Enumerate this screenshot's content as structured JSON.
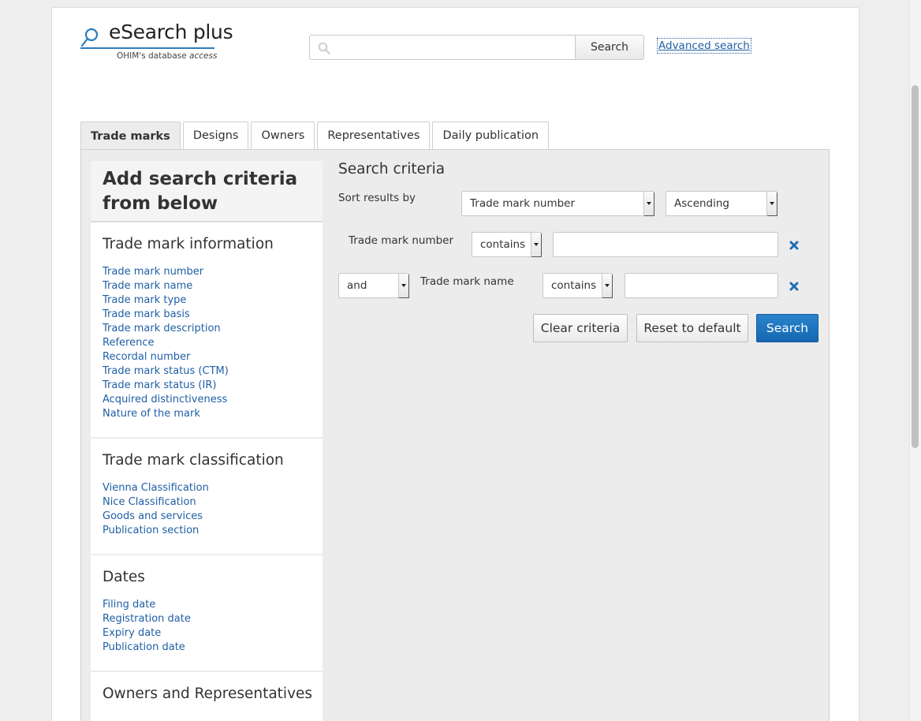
{
  "header": {
    "logo_title": "eSearch plus",
    "logo_subtitle_main": "OHIM's database",
    "logo_subtitle_em": "access",
    "search_placeholder": "",
    "search_button": "Search",
    "advanced_link": "Advanced search"
  },
  "tabs": [
    {
      "label": "Trade marks",
      "active": true
    },
    {
      "label": "Designs",
      "active": false
    },
    {
      "label": "Owners",
      "active": false
    },
    {
      "label": "Representatives",
      "active": false
    },
    {
      "label": "Daily publication",
      "active": false
    }
  ],
  "sidebar": {
    "heading": "Add search criteria from below",
    "sections": [
      {
        "title": "Trade mark information",
        "items": [
          "Trade mark number",
          "Trade mark name",
          "Trade mark type",
          "Trade mark basis",
          "Trade mark description",
          "Reference",
          "Recordal number",
          "Trade mark status (CTM)",
          "Trade mark status (IR)",
          "Acquired distinctiveness",
          "Nature of the mark"
        ]
      },
      {
        "title": "Trade mark classification",
        "items": [
          "Vienna Classification",
          "Nice Classification",
          "Goods and services",
          "Publication section"
        ]
      },
      {
        "title": "Dates",
        "items": [
          "Filing date",
          "Registration date",
          "Expiry date",
          "Publication date"
        ]
      },
      {
        "title": "Owners and Representatives",
        "items": []
      }
    ]
  },
  "criteria": {
    "title": "Search criteria",
    "sort_label": "Sort results by",
    "sort_field": "Trade mark number",
    "sort_order": "Ascending",
    "rows": [
      {
        "label": "Trade mark number",
        "operator": "contains",
        "value": ""
      },
      {
        "connector": "and",
        "label": "Trade mark name",
        "operator": "contains",
        "value": ""
      }
    ],
    "buttons": {
      "clear": "Clear criteria",
      "reset": "Reset to default",
      "search": "Search"
    }
  },
  "colors": {
    "link": "#1f5fa6",
    "primary_button": "#1a72bd",
    "remove_icon": "#1f6db3"
  }
}
